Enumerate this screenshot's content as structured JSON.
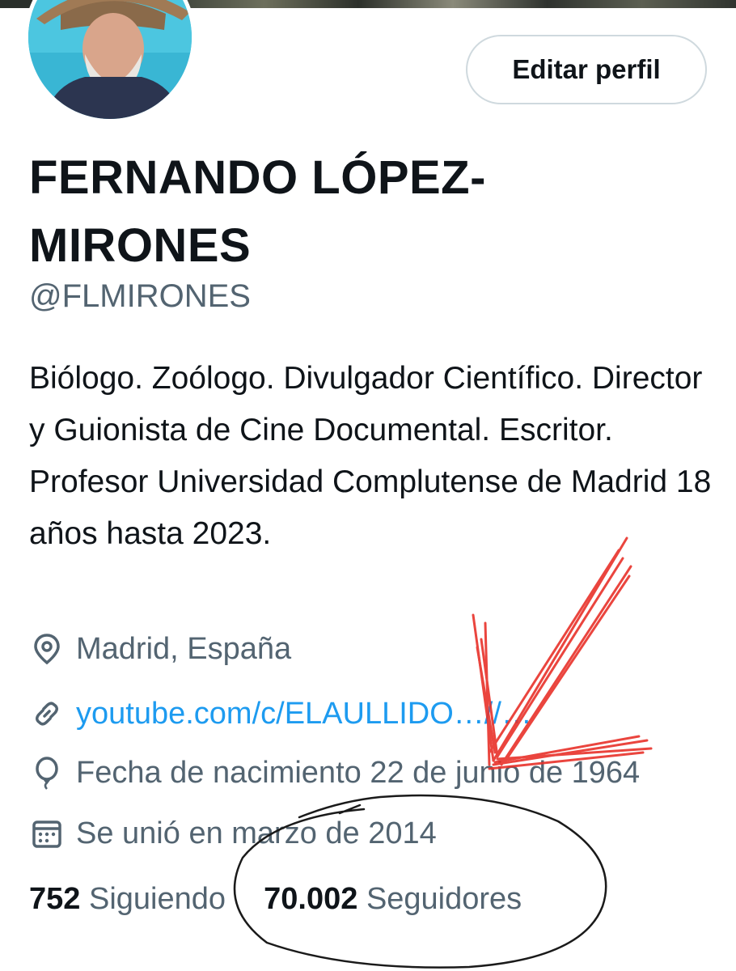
{
  "profile": {
    "edit_button": "Editar perfil",
    "name": "FERNANDO LÓPEZ-MIRONES",
    "handle": "@FLMIRONES",
    "bio": "Biólogo. Zoólogo. Divulgador Científico. Director y Guionista de Cine Documental. Escritor. Profesor Universidad Complutense de Madrid 18 años hasta 2023.",
    "location": "Madrid, España",
    "website": "youtube.com/c/ELAULLIDO…//…",
    "birthday": "Fecha de nacimiento 22 de junio de 1964",
    "joined": "Se unió en marzo de 2014"
  },
  "stats": {
    "following_count": "752",
    "following_label": "Siguiendo",
    "followers_count": "70.002",
    "followers_label": "Seguidores"
  },
  "icons": {
    "location": "map-pin-icon",
    "website": "link-icon",
    "birthday": "balloon-icon",
    "joined": "calendar-icon"
  },
  "colors": {
    "text": "#0f1419",
    "secondary": "#536471",
    "link": "#1d9bf0",
    "annotation_red": "#e8312a",
    "annotation_black": "#1a1a1a"
  }
}
